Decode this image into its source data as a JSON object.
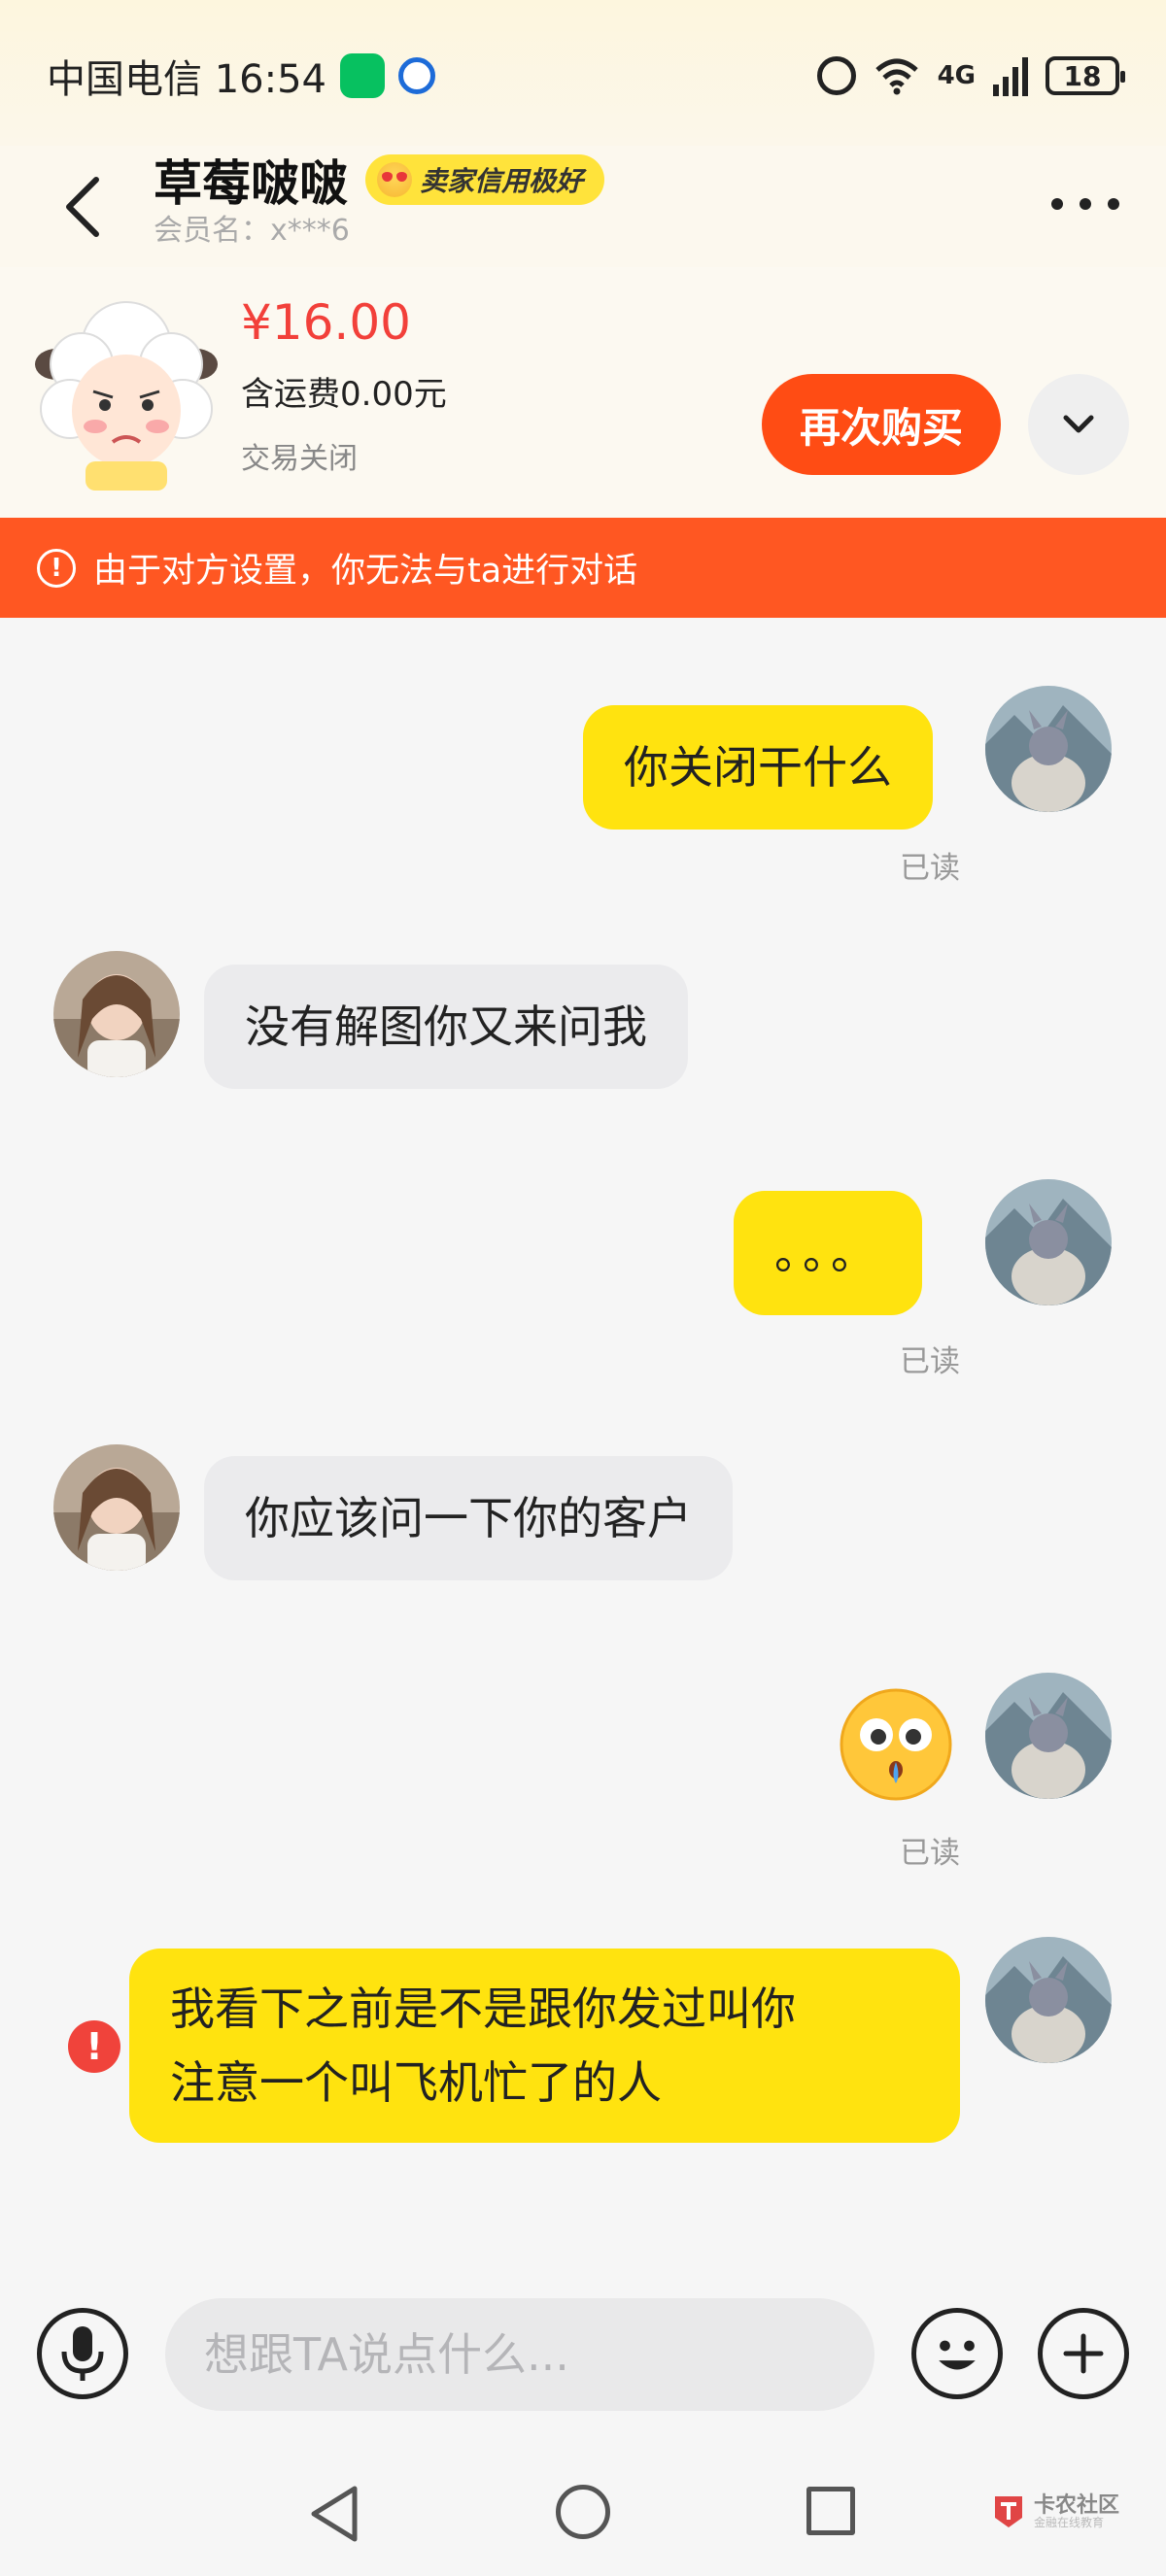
{
  "status_bar": {
    "carrier_time": "中国电信 16:54",
    "network": "4G",
    "battery": "18"
  },
  "header": {
    "title": "草莓啵啵",
    "credit_badge": "卖家信用极好",
    "member_name": "会员名：x***6"
  },
  "product": {
    "price": "¥16.00",
    "shipping": "含运费0.00元",
    "status": "交易关闭",
    "buy_again_label": "再次购买"
  },
  "banner": {
    "text": "由于对方设置，你无法与ta进行对话"
  },
  "messages": [
    {
      "sender": "self",
      "text": "你关闭干什么",
      "read": "已读"
    },
    {
      "sender": "other",
      "text": "没有解图你又来问我"
    },
    {
      "sender": "self",
      "text": "。。。",
      "read": "已读"
    },
    {
      "sender": "other",
      "text": "你应该问一下你的客户"
    },
    {
      "sender": "self",
      "emoji": "surprised-face-emoji",
      "read": "已读"
    },
    {
      "sender": "self",
      "line1": "我看下之前是不是跟你发过叫你",
      "line2": "注意一个叫飞机忙了的人",
      "failed": true
    }
  ],
  "input": {
    "placeholder": "想跟TA说点什么..."
  },
  "watermark": {
    "main": "卡农社区",
    "sub": "金融在线教育"
  },
  "colors": {
    "accent_orange": "#ff4c14",
    "banner": "#ff5722",
    "bubble_self": "#ffe30f",
    "price": "#f2403a"
  }
}
